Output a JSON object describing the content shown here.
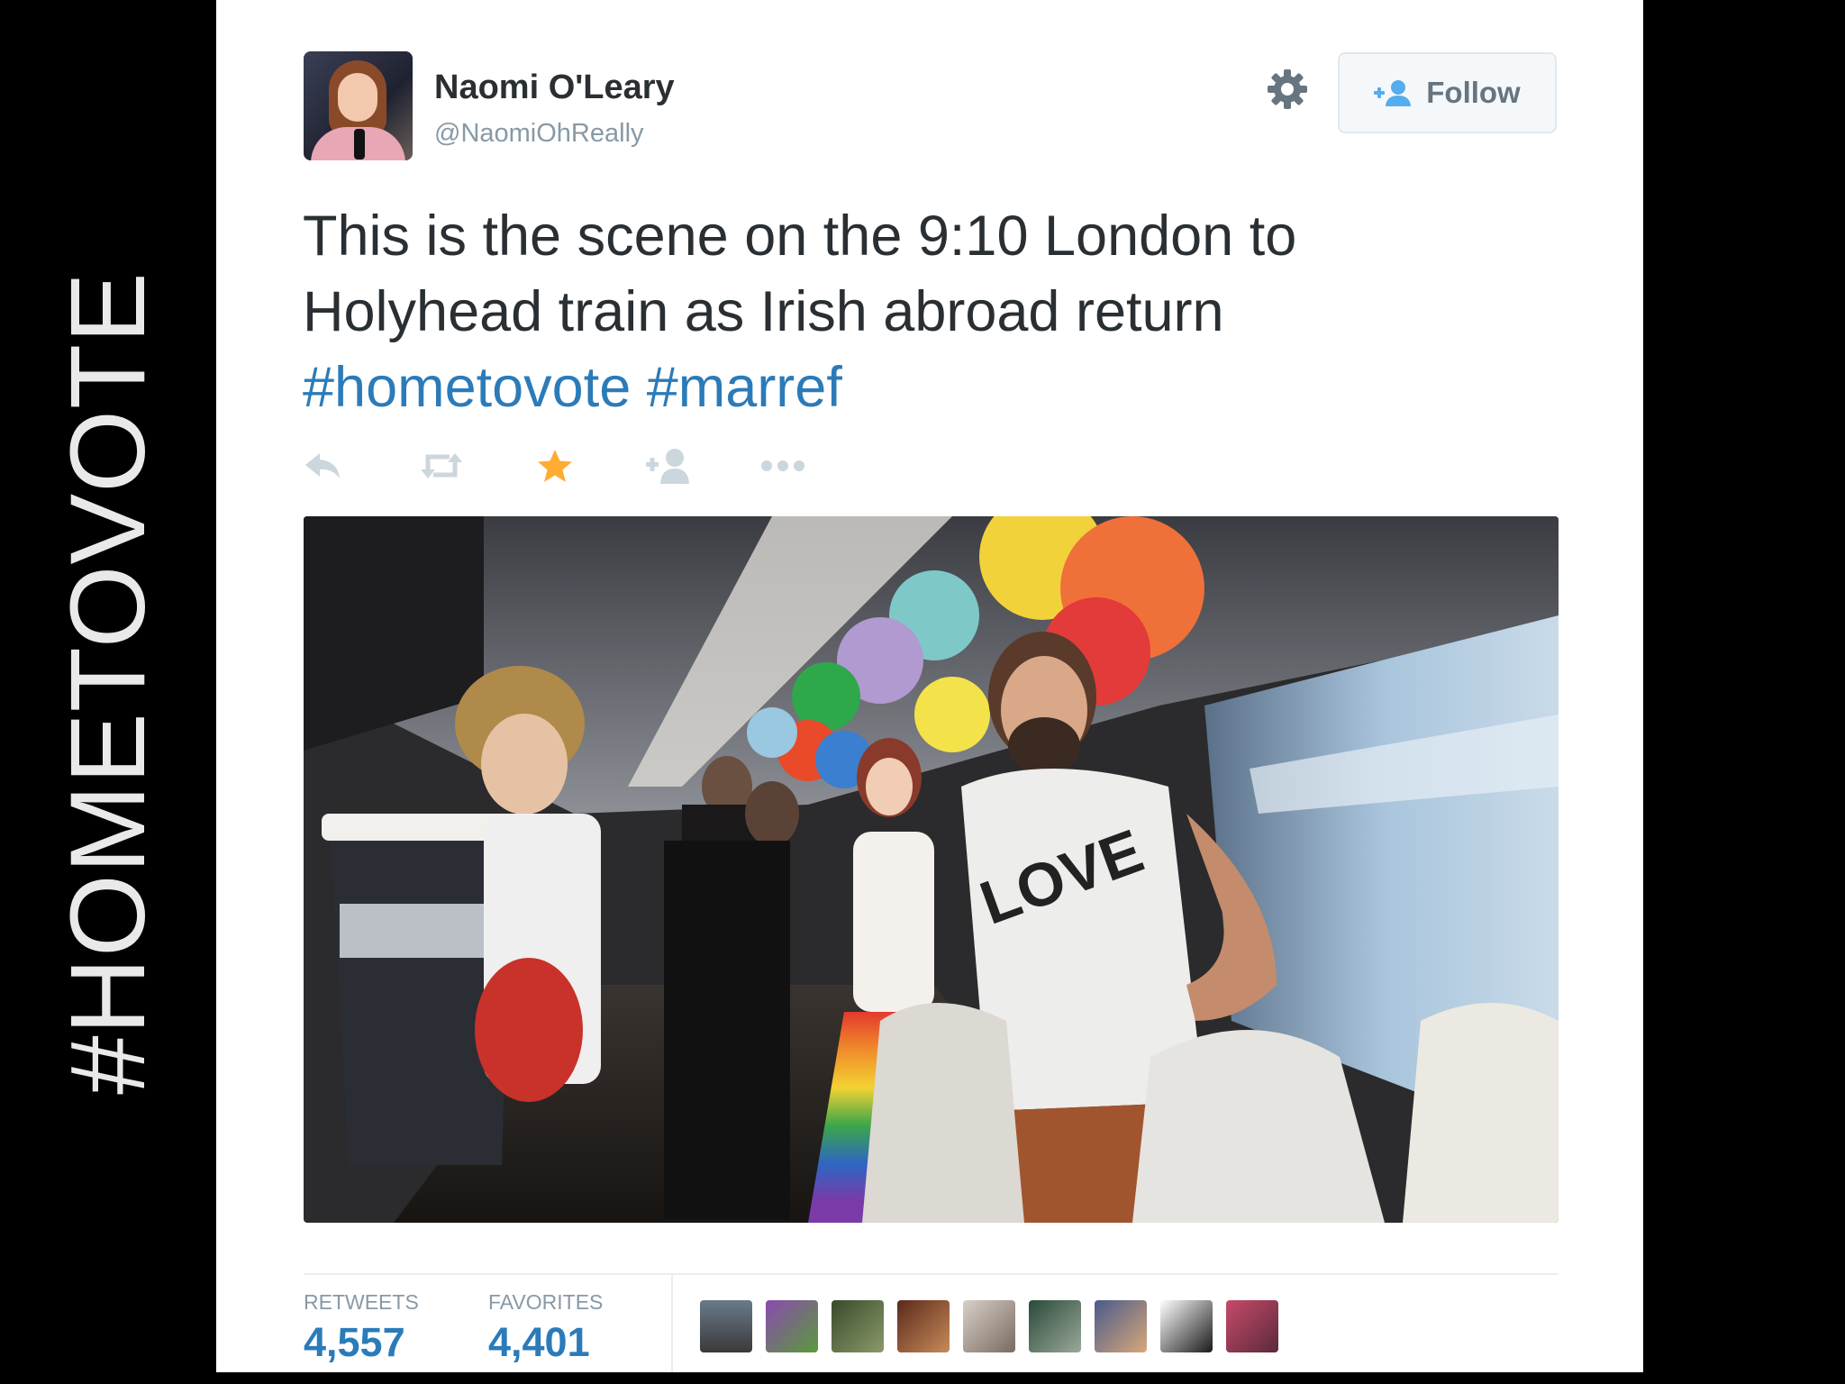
{
  "side_title": "#HOMETOVOTE",
  "tweet": {
    "user": {
      "name": "Naomi O'Leary",
      "handle": "@NaomiOhReally"
    },
    "follow_label": "Follow",
    "text_line1": "This is the scene on the 9:10 London to",
    "text_line2": "Holyhead train as Irish abroad return",
    "hashtags": [
      "#hometovote",
      "#marref"
    ],
    "actions": [
      {
        "name": "reply",
        "icon": "reply-icon",
        "active": false
      },
      {
        "name": "retweet",
        "icon": "retweet-icon",
        "active": false
      },
      {
        "name": "favorite",
        "icon": "star-icon",
        "active": true
      },
      {
        "name": "follow",
        "icon": "add-user-icon",
        "active": false
      },
      {
        "name": "more",
        "icon": "more-icon",
        "active": false
      }
    ],
    "stats": {
      "retweets_label": "RETWEETS",
      "retweets": "4,557",
      "favorites_label": "FAVORITES",
      "favorites": "4,401"
    },
    "favorited_by_count": 9
  },
  "colors": {
    "hashtag": "#2b7bb9",
    "favorite_active": "#ffac33",
    "muted": "#8899a6",
    "text": "#292f33"
  }
}
